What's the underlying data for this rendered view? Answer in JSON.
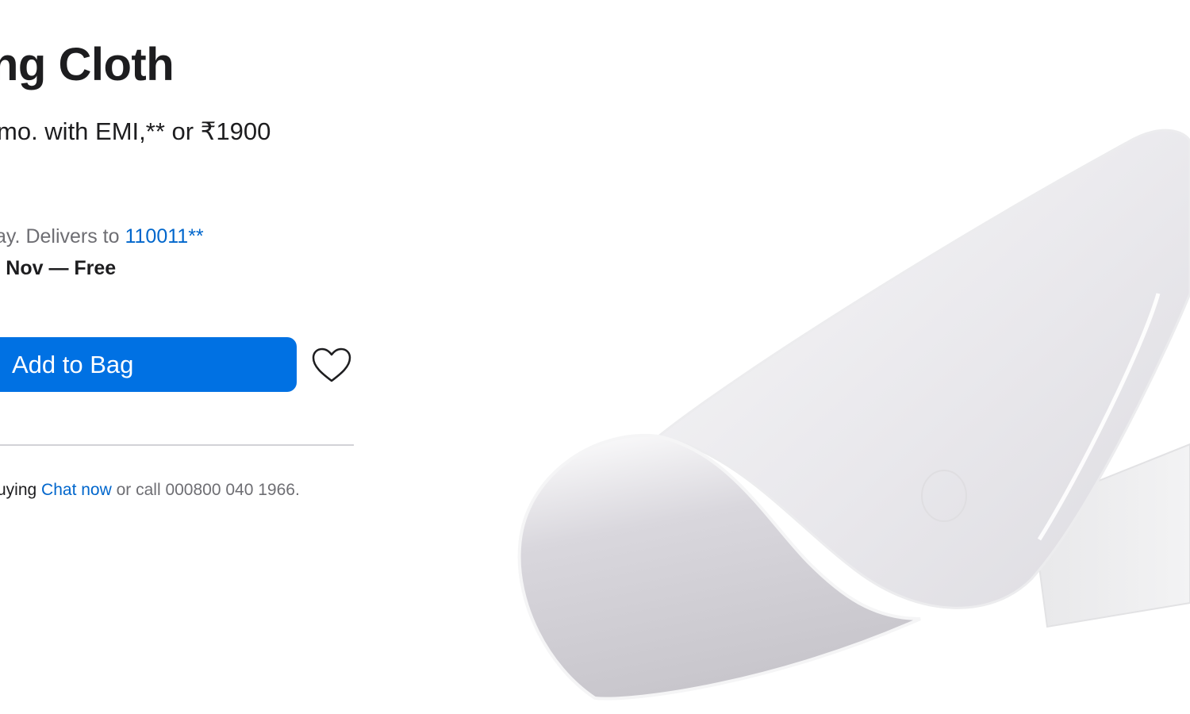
{
  "product": {
    "title": "ng Cloth",
    "price_text": "mo. with EMI,** or ₹1900"
  },
  "delivery": {
    "prefix": "ay. Delivers to ",
    "zip_link": "110011**",
    "date_text": "Nov — Free",
    "date_prefix_glyph": ":"
  },
  "actions": {
    "add_to_bag_label": "Add to Bag",
    "favorite_icon": "heart-outline-icon"
  },
  "help": {
    "prefix": "uying ",
    "chat_link": "Chat now",
    "suffix": " or call 000800 040 1966."
  },
  "colors": {
    "accent": "#0071e3",
    "link": "#0066cc",
    "text": "#1d1d1f",
    "muted": "#6e6e73",
    "divider": "#d2d2d7"
  }
}
